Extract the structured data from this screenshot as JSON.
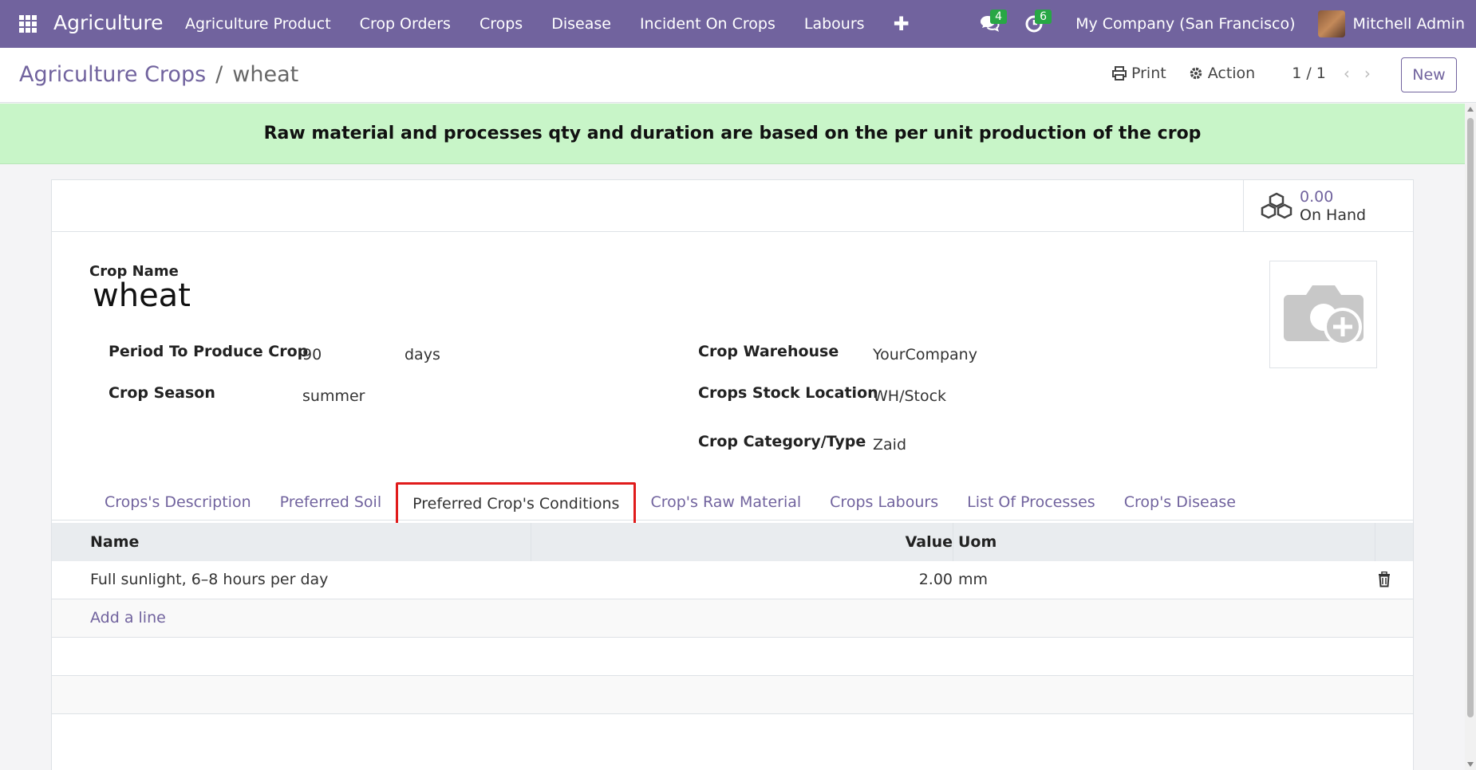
{
  "navbar": {
    "brand": "Agriculture",
    "menu": [
      "Agriculture Product",
      "Crop Orders",
      "Crops",
      "Disease",
      "Incident On Crops",
      "Labours"
    ],
    "messages_count": "4",
    "activities_count": "6",
    "company": "My Company (San Francisco)",
    "user": "Mitchell Admin"
  },
  "breadcrumb": {
    "parent": "Agriculture Crops",
    "separator": "/",
    "current": "wheat"
  },
  "control": {
    "print_label": "Print",
    "action_label": "Action",
    "pager": "1 / 1",
    "new_label": "New"
  },
  "alert": "Raw material and processes qty and duration are based on the per unit production of the crop",
  "stat": {
    "value": "0.00",
    "label": "On Hand"
  },
  "form": {
    "crop_name_label": "Crop Name",
    "crop_name": "wheat",
    "period_label": "Period To Produce Crop",
    "period_value": "90",
    "period_unit": "days",
    "season_label": "Crop Season",
    "season_value": "summer",
    "warehouse_label": "Crop Warehouse",
    "warehouse_value": "YourCompany",
    "stock_location_label": "Crops Stock Location",
    "stock_location_value": "WH/Stock",
    "category_label": "Crop Category/Type",
    "category_value": "Zaid"
  },
  "tabs": [
    "Crops's Description",
    "Preferred Soil",
    "Preferred Crop's Conditions",
    "Crop's Raw Material",
    "Crops Labours",
    "List Of Processes",
    "Crop's Disease"
  ],
  "active_tab": "Preferred Crop's Conditions",
  "table": {
    "headers": {
      "name": "Name",
      "value": "Value",
      "uom": "Uom"
    },
    "rows": [
      {
        "name": "Full sunlight, 6–8 hours per day",
        "value": "2.00",
        "uom": "mm"
      }
    ],
    "add_line": "Add a line"
  },
  "colors": {
    "primary": "#71639e",
    "alert_bg": "#c8f5c8",
    "badge": "#28a745",
    "highlight": "#e01b1b"
  }
}
